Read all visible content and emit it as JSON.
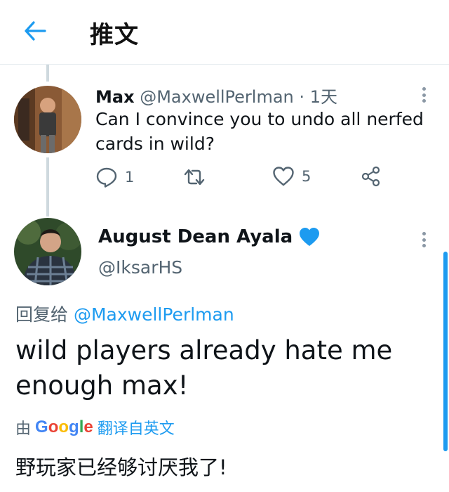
{
  "header": {
    "title": "推文"
  },
  "parent_tweet": {
    "author_name": "Max",
    "handle": "@MaxwellPerlman",
    "separator": "·",
    "time": "1天",
    "text": "Can I convince you to undo all nerfed cards in wild?",
    "reply_count": "1",
    "like_count": "5"
  },
  "main_tweet": {
    "author_name": "August Dean Ayala",
    "verified_icon": "blue-heart",
    "handle": "@IksarHS",
    "reply_to_prefix": "回复给",
    "reply_to_handle": "@MaxwellPerlman",
    "text": "wild players already hate me enough max!",
    "translation_by": "由",
    "translation_provider": "Google",
    "translate_label": "翻译自英文",
    "translated_text": "野玩家已经够讨厌我了!"
  },
  "colors": {
    "accent": "#1d9bf0",
    "muted": "#536471",
    "heart": "#1d9bf0"
  }
}
